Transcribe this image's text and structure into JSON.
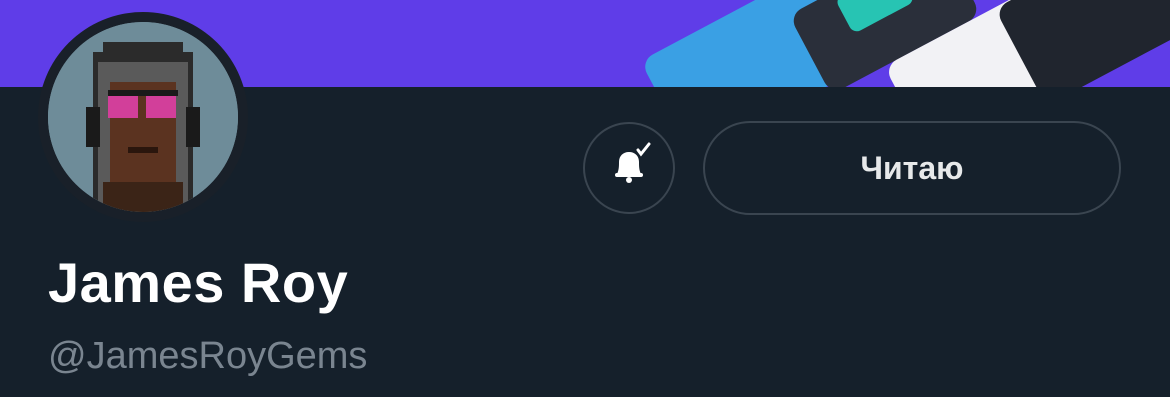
{
  "profile": {
    "display_name": "James Roy",
    "handle": "@JamesRoyGems",
    "follow_button_label": "Читаю"
  },
  "icons": {
    "notify": "bell-check-icon",
    "avatar": "pixel-art-avatar"
  },
  "colors": {
    "banner": "#5f3de8",
    "background": "#192029",
    "button_border": "#3a4550",
    "text_primary": "#ffffff",
    "text_secondary": "#7a8590"
  }
}
